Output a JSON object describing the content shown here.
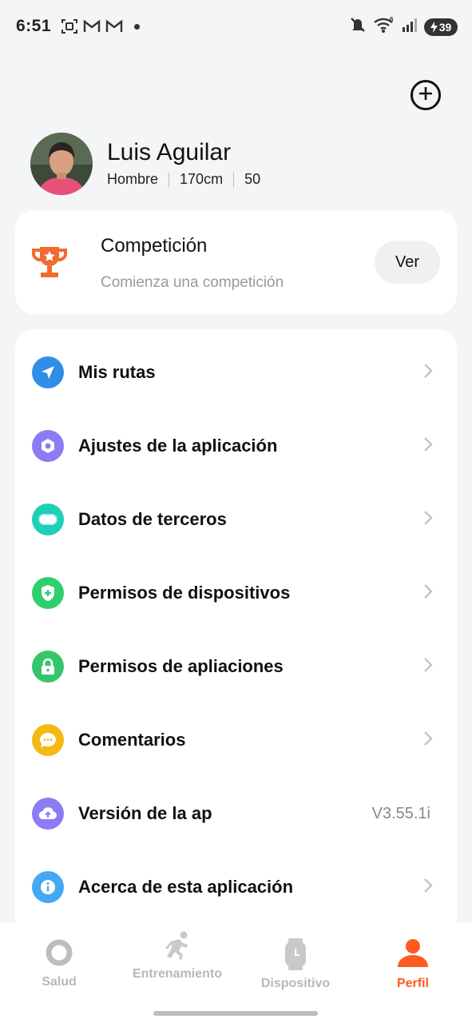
{
  "status_bar": {
    "time": "6:51",
    "battery": "39",
    "icons": [
      "screenshot-icon",
      "gmail-icon",
      "gmail-icon",
      "notification-dot",
      "mute-icon",
      "wifi-6-icon",
      "signal-icon",
      "battery-charging-icon"
    ]
  },
  "header": {
    "add_icon": "plus-circle-icon"
  },
  "profile": {
    "name": "Luis Aguilar",
    "gender": "Hombre",
    "height": "170cm",
    "weight": "50"
  },
  "competition": {
    "title": "Competición",
    "subtitle": "Comienza una competición",
    "button_label": "Ver",
    "icon": "trophy-icon",
    "icon_color": "#f26a2e"
  },
  "menu": {
    "items": [
      {
        "label": "Mis rutas",
        "icon": "send-icon",
        "color": "#2f8ee8",
        "value": ""
      },
      {
        "label": "Ajustes de la aplicación",
        "icon": "settings-icon",
        "color": "#8b7cf6",
        "value": ""
      },
      {
        "label": "Datos de terceros",
        "icon": "toggle-icon",
        "color": "#1fcfb7",
        "value": ""
      },
      {
        "label": "Permisos de dispositivos",
        "icon": "shield-icon",
        "color": "#2fcf6b",
        "value": ""
      },
      {
        "label": "Permisos de apliaciones",
        "icon": "lock-icon",
        "color": "#33c76a",
        "value": ""
      },
      {
        "label": "Comentarios",
        "icon": "chat-icon",
        "color": "#f6b914",
        "value": ""
      },
      {
        "label": "Versión de la ap",
        "icon": "upload-cloud-icon",
        "color": "#8b7cf6",
        "value": "V3.55.1i"
      },
      {
        "label": "Acerca de esta aplicación",
        "icon": "info-icon",
        "color": "#42a9f2",
        "value": ""
      }
    ]
  },
  "bottom_nav": {
    "items": [
      {
        "label": "Salud",
        "icon": "ring-icon",
        "active": false
      },
      {
        "label": "Entrenamiento",
        "icon": "running-icon",
        "active": false
      },
      {
        "label": "Dispositivo",
        "icon": "watch-icon",
        "active": false
      },
      {
        "label": "Perfil",
        "icon": "person-icon",
        "active": true
      }
    ],
    "active_color": "#ff5a1f",
    "inactive_color": "#b8b8b8"
  }
}
